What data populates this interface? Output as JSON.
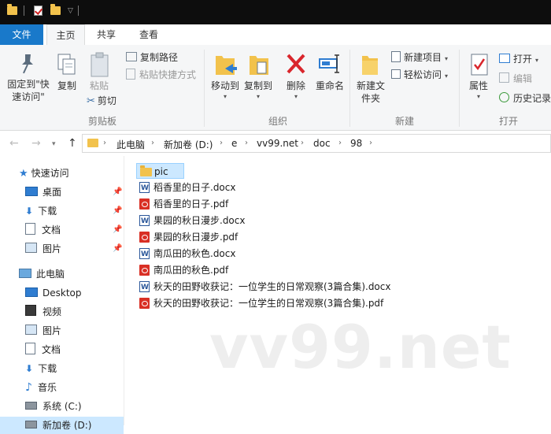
{
  "ribbon_tabs": {
    "file": "文件",
    "home": "主页",
    "share": "共享",
    "view": "查看"
  },
  "ribbon": {
    "clipboard": {
      "pin_quick_access": "固定到\"快速访问\"",
      "copy": "复制",
      "paste": "粘贴",
      "copy_path": "复制路径",
      "paste_shortcut": "粘贴快捷方式",
      "cut": "剪切",
      "group_label": "剪贴板"
    },
    "organize": {
      "move_to": "移动到",
      "copy_to": "复制到",
      "delete": "删除",
      "rename": "重命名",
      "group_label": "组织"
    },
    "new": {
      "new_folder": "新建文件夹",
      "new_item": "新建项目",
      "easy_access": "轻松访问",
      "group_label": "新建"
    },
    "open": {
      "properties": "属性",
      "open": "打开",
      "edit": "编辑",
      "history": "历史记录",
      "group_label": "打开"
    }
  },
  "breadcrumb": [
    "此电脑",
    "新加卷 (D:)",
    "e",
    "vv99.net",
    "doc",
    "98"
  ],
  "nav": {
    "quick_access": "快速访问",
    "desktop": "桌面",
    "downloads": "下载",
    "documents": "文档",
    "pictures": "图片",
    "this_pc": "此电脑",
    "desktop_en": "Desktop",
    "videos": "视频",
    "pictures2": "图片",
    "documents2": "文档",
    "downloads2": "下载",
    "music": "音乐",
    "system_c": "系统 (C:)",
    "new_volume_d": "新加卷 (D:)"
  },
  "files": [
    {
      "name": "pic",
      "type": "folder"
    },
    {
      "name": "稻香里的日子.docx",
      "type": "docx"
    },
    {
      "name": "稻香里的日子.pdf",
      "type": "pdf"
    },
    {
      "name": "果园的秋日漫步.docx",
      "type": "docx"
    },
    {
      "name": "果园的秋日漫步.pdf",
      "type": "pdf"
    },
    {
      "name": "南瓜田的秋色.docx",
      "type": "docx"
    },
    {
      "name": "南瓜田的秋色.pdf",
      "type": "pdf"
    },
    {
      "name": "秋天的田野收获记：一位学生的日常观察(3篇合集).docx",
      "type": "docx"
    },
    {
      "name": "秋天的田野收获记：一位学生的日常观察(3篇合集).pdf",
      "type": "pdf"
    }
  ],
  "watermark": "vv99.net",
  "colors": {
    "accent": "#1979ca",
    "selection": "#cce8ff",
    "folder": "#f2c24c",
    "pdf": "#d93025",
    "delete": "#d9262c"
  }
}
